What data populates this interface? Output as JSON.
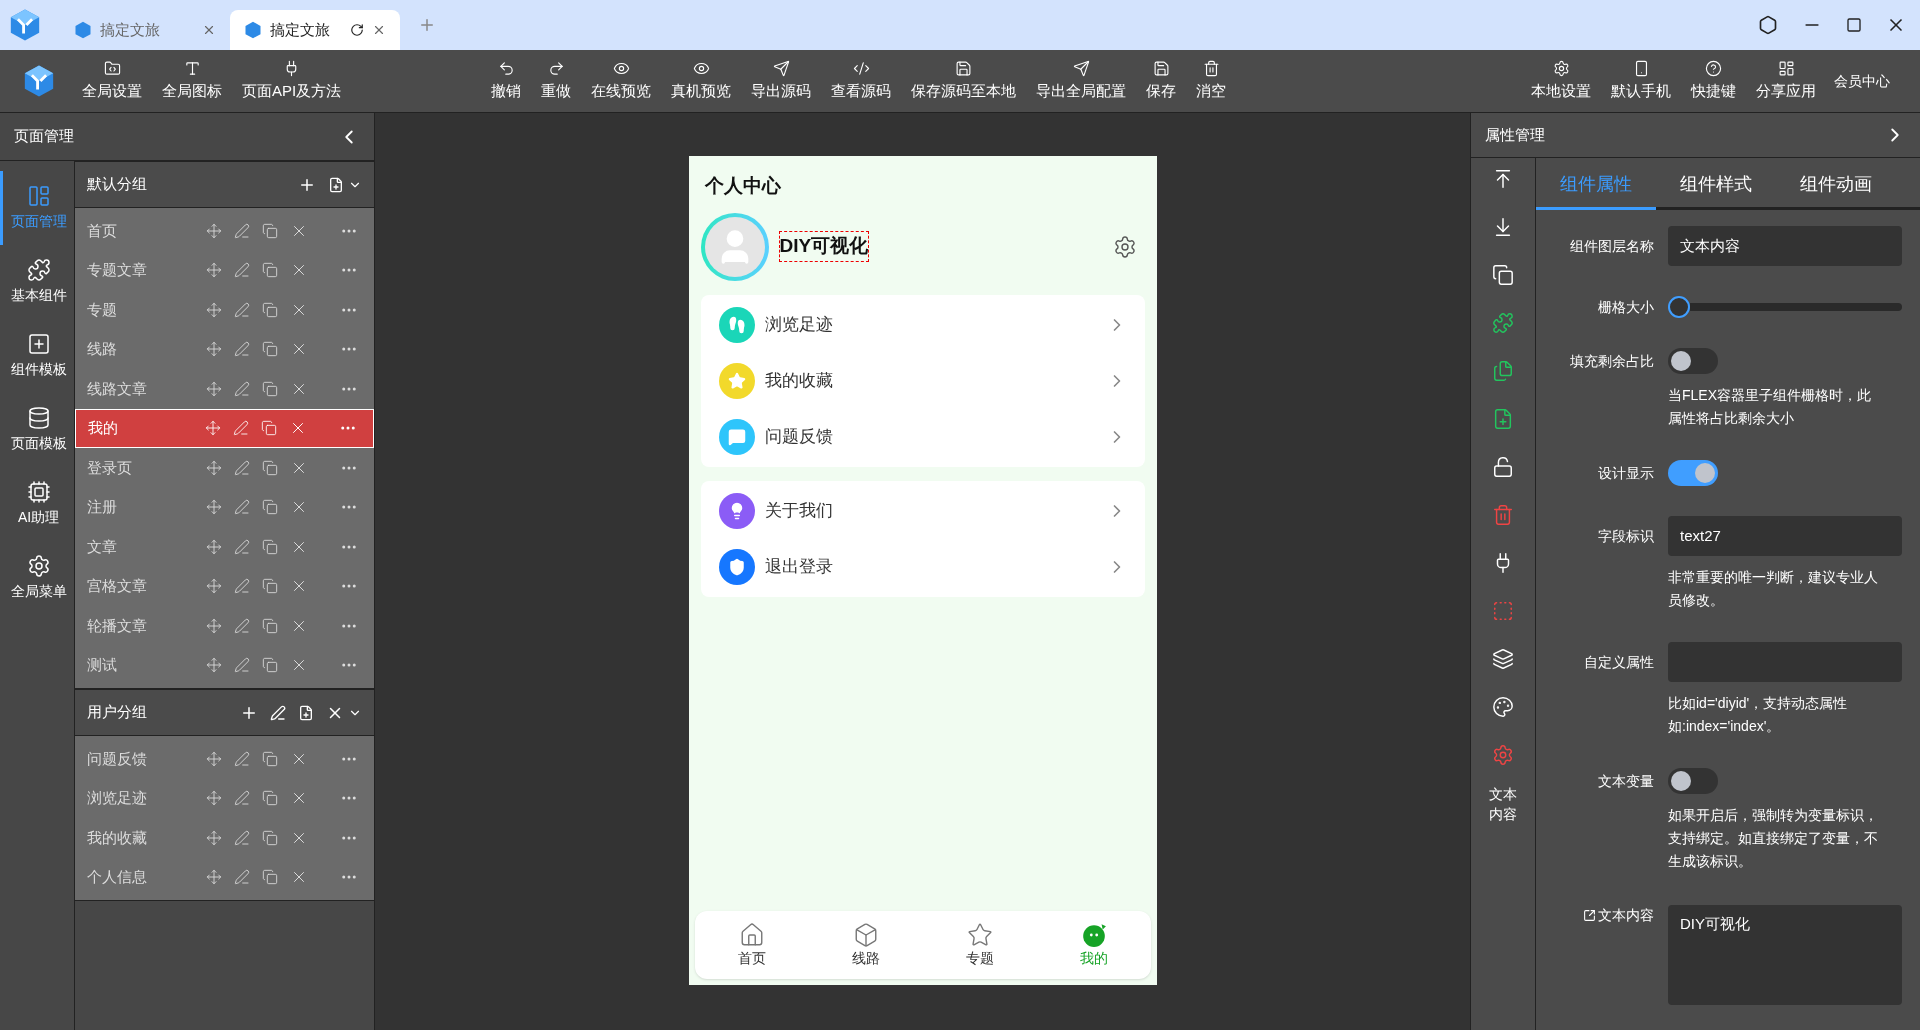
{
  "browser_tabs": [
    {
      "title": "搞定文旅",
      "selected": false
    },
    {
      "title": "搞定文旅",
      "selected": true
    }
  ],
  "toolbar": {
    "left": [
      "全局设置",
      "全局图标",
      "页面API及方法"
    ],
    "center": [
      "撤销",
      "重做",
      "在线预览",
      "真机预览",
      "导出源码",
      "查看源码",
      "保存源码至本地",
      "导出全局配置",
      "保存",
      "消空"
    ],
    "right": [
      "本地设置",
      "默认手机",
      "快捷键",
      "分享应用"
    ],
    "member": "会员中心"
  },
  "left_panel": {
    "title": "页面管理",
    "nav": [
      {
        "label": "页面管理",
        "selected": true
      },
      {
        "label": "基本组件",
        "selected": false
      },
      {
        "label": "组件模板",
        "selected": false
      },
      {
        "label": "页面模板",
        "selected": false
      },
      {
        "label": "AI助理",
        "selected": false
      },
      {
        "label": "全局菜单",
        "selected": false
      }
    ],
    "groups": [
      {
        "name": "默认分组",
        "editable": false,
        "pages": [
          {
            "name": "首页",
            "selected": false
          },
          {
            "name": "专题文章",
            "selected": false
          },
          {
            "name": "专题",
            "selected": false
          },
          {
            "name": "线路",
            "selected": false
          },
          {
            "name": "线路文章",
            "selected": false
          },
          {
            "name": "我的",
            "selected": true
          },
          {
            "name": "登录页",
            "selected": false
          },
          {
            "name": "注册",
            "selected": false
          },
          {
            "name": "文章",
            "selected": false
          },
          {
            "name": "宫格文章",
            "selected": false
          },
          {
            "name": "轮播文章",
            "selected": false
          },
          {
            "name": "测试",
            "selected": false
          }
        ]
      },
      {
        "name": "用户分组",
        "editable": true,
        "pages": [
          {
            "name": "问题反馈",
            "selected": false
          },
          {
            "name": "浏览足迹",
            "selected": false
          },
          {
            "name": "我的收藏",
            "selected": false
          },
          {
            "name": "个人信息",
            "selected": false
          }
        ]
      }
    ]
  },
  "phone": {
    "title": "个人中心",
    "user_name": "DIY可视化",
    "menu_groups": [
      [
        {
          "label": "浏览足迹",
          "color": "#1ad6b8"
        },
        {
          "label": "我的收藏",
          "color": "#f2d92b"
        },
        {
          "label": "问题反馈",
          "color": "#2ec5fb"
        }
      ],
      [
        {
          "label": "关于我们",
          "color": "#8b5cf6"
        },
        {
          "label": "退出登录",
          "color": "#1677ff"
        }
      ]
    ],
    "tabbar": [
      {
        "label": "首页",
        "selected": false
      },
      {
        "label": "线路",
        "selected": false
      },
      {
        "label": "专题",
        "selected": false
      },
      {
        "label": "我的",
        "selected": true
      }
    ]
  },
  "right_panel": {
    "title": "属性管理",
    "side_label": "文本内容",
    "tabs": [
      {
        "label": "组件属性",
        "selected": true
      },
      {
        "label": "组件样式",
        "selected": false
      },
      {
        "label": "组件动画",
        "selected": false
      }
    ],
    "fields": [
      {
        "kind": "input",
        "label": "组件图层名称",
        "value": "文本内容"
      },
      {
        "kind": "slider",
        "label": "栅格大小",
        "level": 0
      },
      {
        "kind": "switch",
        "label": "填充剩余占比",
        "on": false,
        "hint": "当FLEX容器里子组件栅格时，此属性将占比剩余大小"
      },
      {
        "kind": "switch",
        "label": "设计显示",
        "on": true
      },
      {
        "kind": "input",
        "label": "字段标识",
        "value": "text27",
        "hint": "非常重要的唯一判断，建议专业人员修改。"
      },
      {
        "kind": "input",
        "label": "自定义属性",
        "hint": "比如id='diyid'，支持动态属性如:index='index'。"
      },
      {
        "kind": "switch",
        "label": "文本变量",
        "on": false,
        "hint": "如果开启后，强制转为变量标识，支持绑定。如直接绑定了变量，不生成该标识。"
      },
      {
        "kind": "textarea",
        "label": "文本内容",
        "value": "DIY可视化"
      }
    ]
  }
}
